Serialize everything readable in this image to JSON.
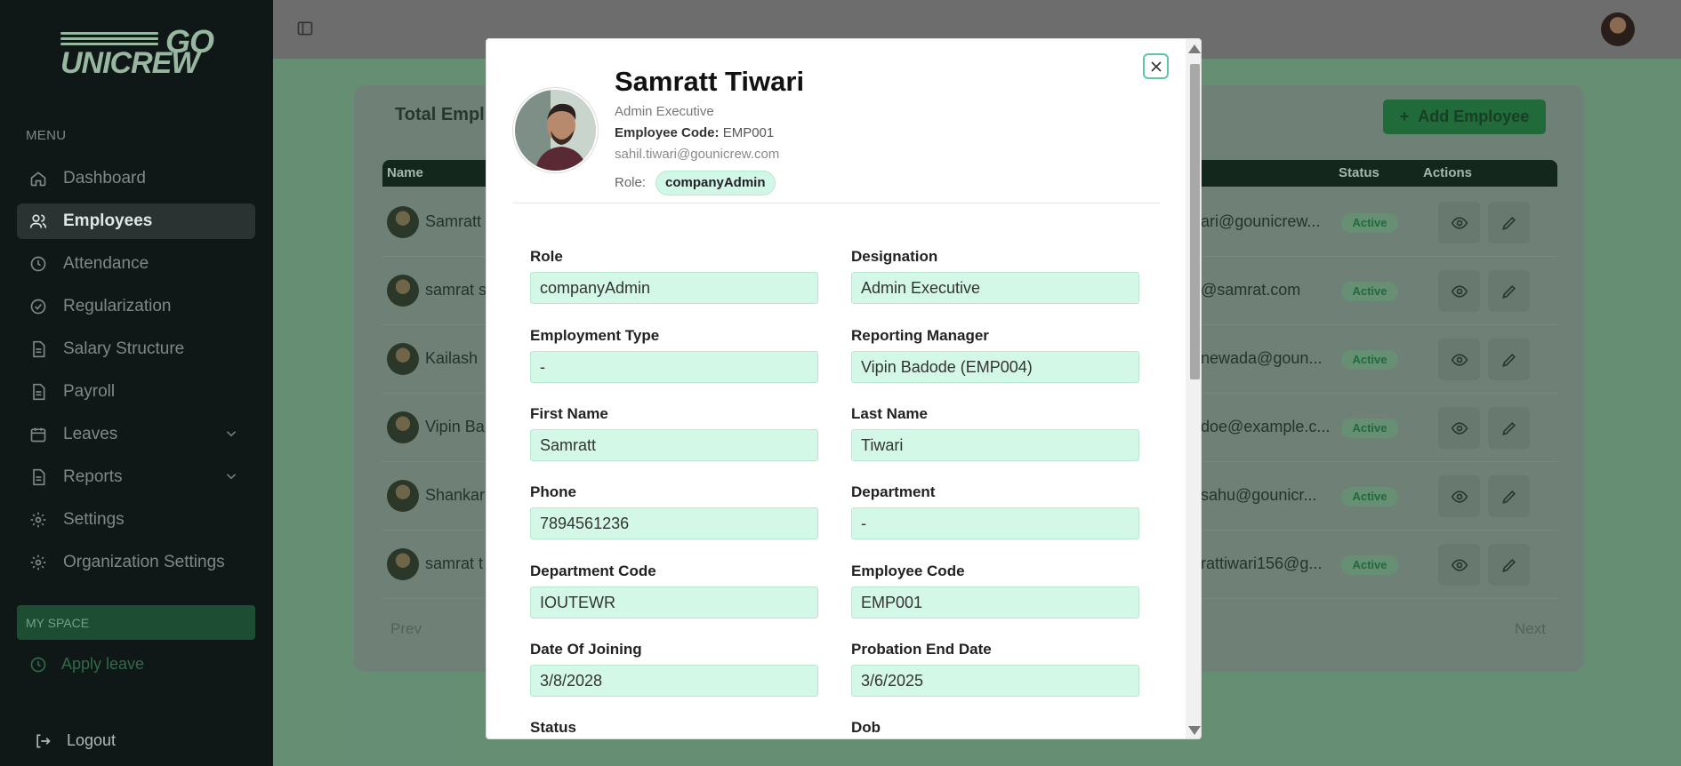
{
  "brand": {
    "go": "GO",
    "unicrew": "UNICREW"
  },
  "sidebar": {
    "menu_title": "MENU",
    "items": [
      {
        "label": "Dashboard",
        "icon": "home-icon"
      },
      {
        "label": "Employees",
        "icon": "users-icon",
        "active": true
      },
      {
        "label": "Attendance",
        "icon": "clock-icon"
      },
      {
        "label": "Regularization",
        "icon": "check-circle-icon"
      },
      {
        "label": "Salary Structure",
        "icon": "document-icon"
      },
      {
        "label": "Payroll",
        "icon": "document-icon"
      },
      {
        "label": "Leaves",
        "icon": "calendar-icon",
        "expandable": true
      },
      {
        "label": "Reports",
        "icon": "document-icon",
        "expandable": true
      },
      {
        "label": "Settings",
        "icon": "gear-icon"
      },
      {
        "label": "Organization Settings",
        "icon": "gear-icon"
      }
    ],
    "myspace": "MY SPACE",
    "apply_leave": "Apply leave",
    "logout": "Logout"
  },
  "main": {
    "title": "Total Empl",
    "add_button": "Add Employee",
    "columns": {
      "name": "Name",
      "status": "Status",
      "actions": "Actions"
    },
    "rows": [
      {
        "name": "Samratt",
        "email": "ari@gounicrew...",
        "status": "Active"
      },
      {
        "name": "samrat s",
        "email": "@samrat.com",
        "status": "Active"
      },
      {
        "name": "Kailash",
        "email": "newada@goun...",
        "status": "Active"
      },
      {
        "name": "Vipin Ba",
        "email": "doe@example.c...",
        "status": "Active"
      },
      {
        "name": "Shankar",
        "email": "sahu@gounicr...",
        "status": "Active"
      },
      {
        "name": "samrat t",
        "email": "rattiwari156@g...",
        "status": "Active"
      }
    ],
    "prev": "Prev",
    "next": "Next"
  },
  "modal": {
    "name": "Samratt Tiwari",
    "designation": "Admin Executive",
    "code_label": "Employee Code:",
    "code_value": "EMP001",
    "email": "sahil.tiwari@gounicrew.com",
    "role_label": "Role:",
    "role_value": "companyAdmin",
    "fields": [
      {
        "label": "Role",
        "value": "companyAdmin"
      },
      {
        "label": "Designation",
        "value": "Admin Executive"
      },
      {
        "label": "Employment Type",
        "value": "-"
      },
      {
        "label": "Reporting Manager",
        "value": "Vipin Badode (EMP004)"
      },
      {
        "label": "First Name",
        "value": "Samratt"
      },
      {
        "label": "Last Name",
        "value": "Tiwari"
      },
      {
        "label": "Phone",
        "value": "7894561236"
      },
      {
        "label": "Department",
        "value": "-"
      },
      {
        "label": "Department Code",
        "value": "IOUTEWR"
      },
      {
        "label": "Employee Code",
        "value": "EMP001"
      },
      {
        "label": "Date Of Joining",
        "value": "3/8/2028"
      },
      {
        "label": "Probation End Date",
        "value": "3/6/2025"
      },
      {
        "label": "Status",
        "value": ""
      },
      {
        "label": "Dob",
        "value": ""
      }
    ]
  },
  "colors": {
    "accent": "#1b5e31",
    "field_bg": "#d3f8e7",
    "chip_bg": "#d2f7e8"
  }
}
